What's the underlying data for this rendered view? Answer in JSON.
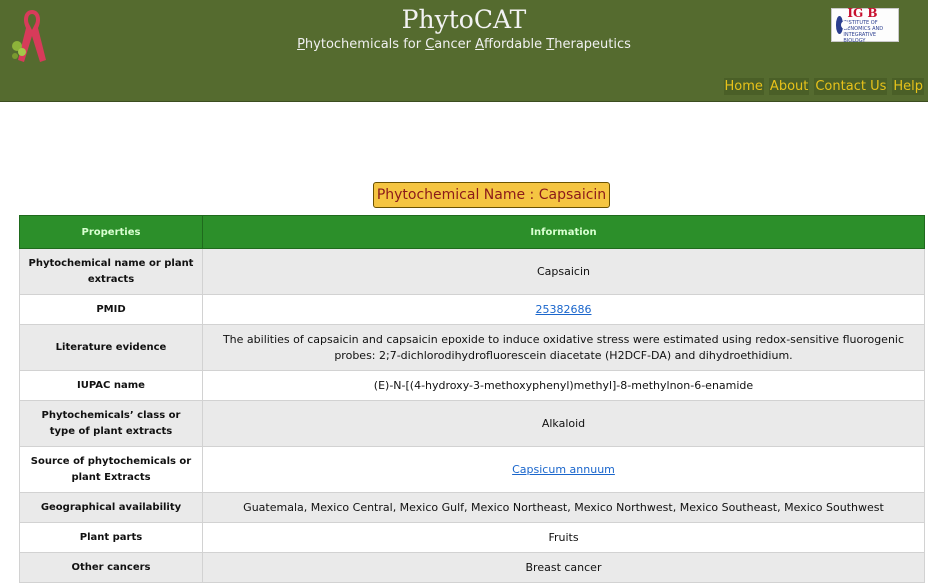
{
  "header": {
    "title": "PhytoCAT",
    "subtitle_parts": [
      {
        "t": "P",
        "u": true
      },
      {
        "t": "hytochemicals for ",
        "u": false
      },
      {
        "t": "C",
        "u": true
      },
      {
        "t": "ancer ",
        "u": false
      },
      {
        "t": "A",
        "u": true
      },
      {
        "t": "ffordable ",
        "u": false
      },
      {
        "t": "T",
        "u": true
      },
      {
        "t": "herapeutics",
        "u": false
      }
    ],
    "logo_text": "IG B",
    "logo_small": "INSTITUTE OF GENOMICS AND INTEGRATIVE BIOLOGY"
  },
  "nav": [
    "Home",
    "About",
    "Contact Us",
    "Help"
  ],
  "phytochemical_label": "Phytochemical Name : Capsaicin",
  "table": {
    "headers": [
      "Properties",
      "Information"
    ],
    "rows": [
      {
        "key": "Phytochemical name or plant extracts",
        "value": "Capsaicin",
        "link": false
      },
      {
        "key": "PMID",
        "value": "25382686",
        "link": true
      },
      {
        "key": "Literature evidence",
        "value": "The abilities of capsaicin and capsaicin epoxide to induce oxidative stress were estimated using redox-sensitive fluorogenic probes: 2;7-dichlorodihydrofluorescein diacetate (H2DCF-DA) and dihydroethidium.",
        "link": false
      },
      {
        "key": "IUPAC name",
        "value": "(E)-N-[(4-hydroxy-3-methoxyphenyl)methyl]-8-methylnon-6-enamide",
        "link": false
      },
      {
        "key": "Phytochemicals’ class or type of plant extracts",
        "value": "Alkaloid",
        "link": false
      },
      {
        "key": "Source of phytochemicals or plant Extracts",
        "value": "Capsicum annuum",
        "link": true
      },
      {
        "key": "Geographical availability",
        "value": "Guatemala, Mexico Central, Mexico Gulf, Mexico Northeast, Mexico Northwest, Mexico Southeast, Mexico Southwest",
        "link": false
      },
      {
        "key": "Plant parts",
        "value": "Fruits",
        "link": false
      },
      {
        "key": "Other cancers",
        "value": "Breast cancer",
        "link": false
      }
    ]
  },
  "colors": {
    "header_bg": "#556b2f",
    "nav_text": "#e8c21a",
    "table_header_bg": "#2c8f2a",
    "label_bg": "#f5c542"
  },
  "icons": {
    "ribbon": "cancer-ribbon-icon",
    "logo": "igib-logo"
  }
}
